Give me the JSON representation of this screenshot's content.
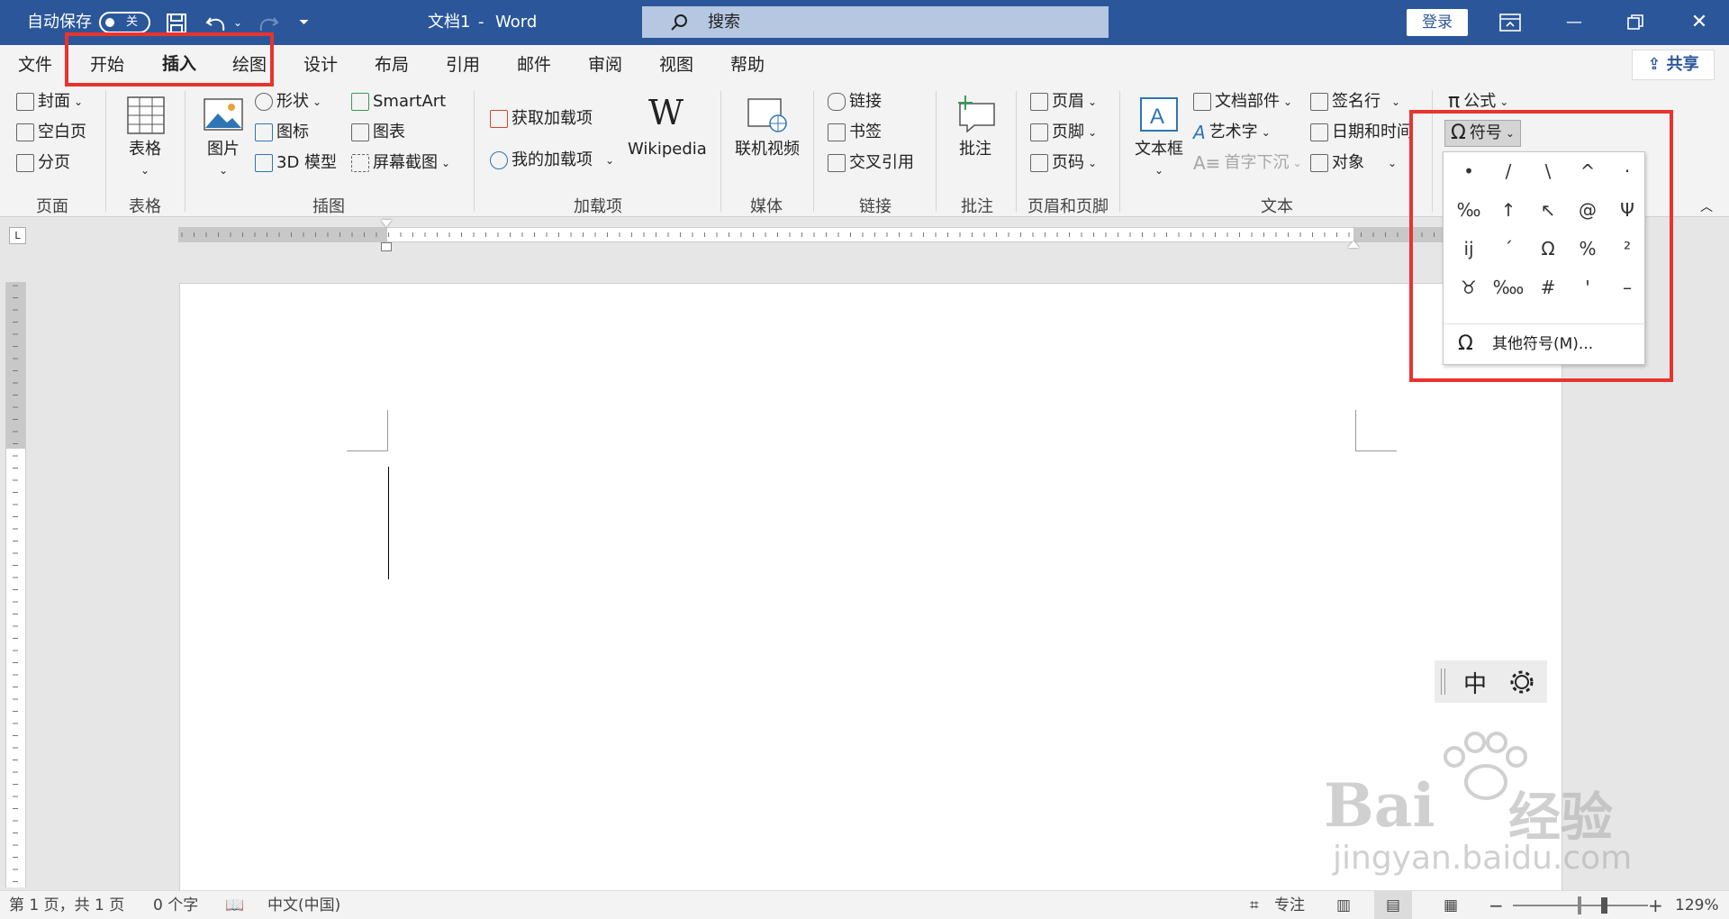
{
  "titlebar": {
    "autosave_label": "自动保存",
    "autosave_state": "关",
    "doc_name": "文档1",
    "separator": "-",
    "app_name": "Word",
    "search_placeholder": "搜索",
    "login_label": "登录"
  },
  "tabs": [
    "文件",
    "开始",
    "插入",
    "绘图",
    "设计",
    "布局",
    "引用",
    "邮件",
    "审阅",
    "视图",
    "帮助"
  ],
  "active_tab": "插入",
  "share_label": "共享",
  "ribbon": {
    "pages": {
      "items": [
        "封面",
        "空白页",
        "分页"
      ],
      "group": "页面"
    },
    "table": {
      "label": "表格",
      "group": "表格"
    },
    "illustrations": {
      "picture": "图片",
      "shapes": "形状",
      "icons": "图标",
      "model3d": "3D 模型",
      "smartart": "SmartArt",
      "chart": "图表",
      "screenshot": "屏幕截图",
      "group": "插图"
    },
    "addins": {
      "get": "获取加载项",
      "my": "我的加载项",
      "wikipedia": "Wikipedia",
      "group": "加载项"
    },
    "media": {
      "online_video": "联机视频",
      "group": "媒体"
    },
    "links": {
      "link": "链接",
      "bookmark": "书签",
      "crossref": "交叉引用",
      "group": "链接"
    },
    "comments": {
      "comment": "批注",
      "group": "批注"
    },
    "header_footer": {
      "header": "页眉",
      "footer": "页脚",
      "page_number": "页码",
      "group": "页眉和页脚"
    },
    "text": {
      "textbox": "文本框",
      "quickparts": "文档部件",
      "wordart": "艺术字",
      "dropcap": "首字下沉",
      "signature": "签名行",
      "datetime": "日期和时间",
      "object": "对象",
      "group": "文本"
    },
    "symbols": {
      "equation": "公式",
      "symbol": "符号"
    }
  },
  "symbol_dropdown": {
    "symbols": [
      "•",
      "/",
      "\\",
      "^",
      "·",
      "‰",
      "↑",
      "↖",
      "@",
      "Ψ",
      "ĳ",
      "ˊ",
      "Ω",
      "%",
      "²",
      "♉",
      "‱",
      "#",
      "'",
      "–"
    ],
    "more_label": "其他符号(M)..."
  },
  "ime": {
    "mode": "中"
  },
  "statusbar": {
    "page": "第 1 页，共 1 页",
    "words": "0 个字",
    "language": "中文(中国)",
    "focus": "专注",
    "zoom": "129%"
  },
  "watermark": {
    "brand": "Bai",
    "suffix": "经验",
    "url": "jingyan.baidu.com"
  },
  "colors": {
    "titlebar": "#2b579a",
    "highlight": "#e8332f"
  }
}
